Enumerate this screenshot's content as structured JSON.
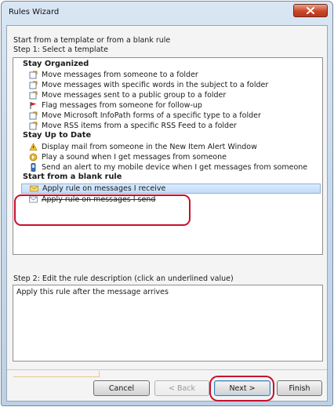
{
  "window": {
    "title": "Rules Wizard"
  },
  "intro": {
    "line1": "Start from a template or from a blank rule",
    "line2": "Step 1: Select a template"
  },
  "template_groups": [
    {
      "name": "Stay Organized",
      "items": [
        {
          "label": "Move messages from someone to a folder",
          "icon": "move-folder-icon"
        },
        {
          "label": "Move messages with specific words in the subject to a folder",
          "icon": "move-folder-icon"
        },
        {
          "label": "Move messages sent to a public group to a folder",
          "icon": "move-folder-icon"
        },
        {
          "label": "Flag messages from someone for follow-up",
          "icon": "flag-icon"
        },
        {
          "label": "Move Microsoft InfoPath forms of a specific type to a folder",
          "icon": "move-folder-icon"
        },
        {
          "label": "Move RSS items from a specific RSS Feed to a folder",
          "icon": "move-folder-icon"
        }
      ]
    },
    {
      "name": "Stay Up to Date",
      "items": [
        {
          "label": "Display mail from someone in the New Item Alert Window",
          "icon": "alert-window-icon"
        },
        {
          "label": "Play a sound when I get messages from someone",
          "icon": "sound-icon"
        },
        {
          "label": "Send an alert to my mobile device when I get messages from someone",
          "icon": "mobile-device-icon"
        }
      ]
    },
    {
      "name": "Start from a blank rule",
      "items": [
        {
          "label": "Apply rule on messages I receive",
          "icon": "envelope-icon",
          "selected": true
        },
        {
          "label": "Apply rule on messages I send",
          "icon": "send-envelope-icon"
        }
      ]
    }
  ],
  "step2": {
    "label": "Step 2: Edit the rule description (click an underlined value)",
    "description": "Apply this rule after the message arrives"
  },
  "buttons": {
    "cancel": "Cancel",
    "back": "< Back",
    "next": "Next >",
    "finish": "Finish"
  },
  "colors": {
    "selection": "#c2dcf7",
    "annotation": "#c8102e",
    "close_button": "#c9472b"
  }
}
